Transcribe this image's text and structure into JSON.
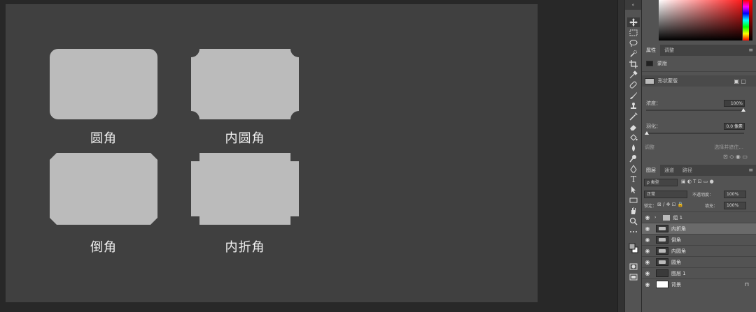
{
  "canvas": {
    "shapes": [
      {
        "label": "圆角"
      },
      {
        "label": "内圆角"
      },
      {
        "label": "倒角"
      },
      {
        "label": "内折角"
      }
    ]
  },
  "colors": {
    "shape_fill": "#bbbbbb",
    "canvas_bg": "#404040",
    "workspace_bg": "#282828",
    "panel_bg": "#535353"
  },
  "toolbar": {
    "collapse_label": "«",
    "tools": [
      "move-icon",
      "marquee-icon",
      "lasso-icon",
      "quick-select-icon",
      "crop-icon",
      "eyedropper-icon",
      "healing-icon",
      "brush-icon",
      "stamp-icon",
      "history-brush-icon",
      "eraser-icon",
      "paint-bucket-icon",
      "blur-icon",
      "dodge-icon",
      "pen-icon",
      "type-icon",
      "path-select-icon",
      "rectangle-icon",
      "hand-icon",
      "zoom-icon",
      "more-icon",
      "colors-icon",
      "quick-mask-icon",
      "screen-mode-icon"
    ],
    "type_tool": "T"
  },
  "properties_panel": {
    "tabs": [
      "属性",
      "调整"
    ],
    "mask_title": "蒙版",
    "vector_mask_label": "形状蒙版",
    "density_label": "浓度：",
    "density_value": "100%",
    "feather_label": "羽化：",
    "feather_value": "0.0 像素",
    "refine_label": "调整",
    "select_subject": "选择并遮住..."
  },
  "layers_panel": {
    "tabs": [
      "图层",
      "通道",
      "路径"
    ],
    "filter_label": "ρ 类型",
    "blend_mode": "正常",
    "opacity_label": "不透明度：",
    "opacity_value": "100%",
    "lock_label": "锁定：",
    "fill_label": "填充：",
    "fill_value": "100%",
    "layers": [
      {
        "name": "组 1",
        "type": "group"
      },
      {
        "name": "内折角",
        "type": "shape",
        "selected": true
      },
      {
        "name": "倒角",
        "type": "shape"
      },
      {
        "name": "内圆角",
        "type": "shape"
      },
      {
        "name": "圆角",
        "type": "shape"
      },
      {
        "name": "图层 1",
        "type": "pixel"
      },
      {
        "name": "背景",
        "type": "background"
      }
    ]
  }
}
